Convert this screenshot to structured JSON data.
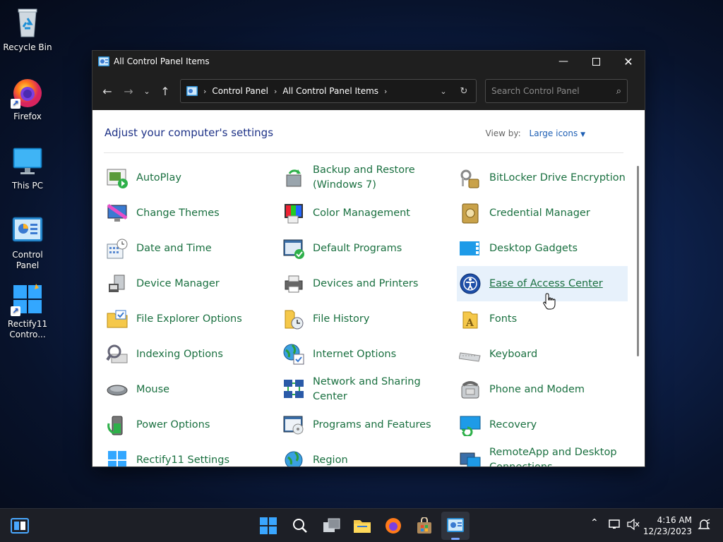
{
  "desktop": {
    "icons": [
      {
        "label": "Recycle Bin"
      },
      {
        "label": "Firefox"
      },
      {
        "label": "This PC"
      },
      {
        "label": "Control Panel"
      },
      {
        "label": "Rectify11 Contro..."
      }
    ]
  },
  "window": {
    "title": "All Control Panel Items",
    "breadcrumb": [
      "Control Panel",
      "All Control Panel Items"
    ],
    "search_placeholder": "Search Control Panel",
    "heading": "Adjust your computer's settings",
    "view_by_label": "View by:",
    "view_by_value": "Large icons",
    "items": [
      {
        "label": "AutoPlay"
      },
      {
        "label": "Backup and Restore (Windows 7)"
      },
      {
        "label": "BitLocker Drive Encryption"
      },
      {
        "label": "Change Themes"
      },
      {
        "label": "Color Management"
      },
      {
        "label": "Credential Manager"
      },
      {
        "label": "Date and Time"
      },
      {
        "label": "Default Programs"
      },
      {
        "label": "Desktop Gadgets"
      },
      {
        "label": "Device Manager"
      },
      {
        "label": "Devices and Printers"
      },
      {
        "label": "Ease of Access Center"
      },
      {
        "label": "File Explorer Options"
      },
      {
        "label": "File History"
      },
      {
        "label": "Fonts"
      },
      {
        "label": "Indexing Options"
      },
      {
        "label": "Internet Options"
      },
      {
        "label": "Keyboard"
      },
      {
        "label": "Mouse"
      },
      {
        "label": "Network and Sharing Center"
      },
      {
        "label": "Phone and Modem"
      },
      {
        "label": "Power Options"
      },
      {
        "label": "Programs and Features"
      },
      {
        "label": "Recovery"
      },
      {
        "label": "Rectify11 Settings"
      },
      {
        "label": "Region"
      },
      {
        "label": "RemoteApp and Desktop Connections"
      }
    ]
  },
  "taskbar": {
    "time": "4:16 AM",
    "date": "12/23/2023"
  },
  "colors": {
    "link_green": "#1a7040",
    "heading_blue": "#1e3287",
    "hover_bg": "#e7f1fb"
  }
}
